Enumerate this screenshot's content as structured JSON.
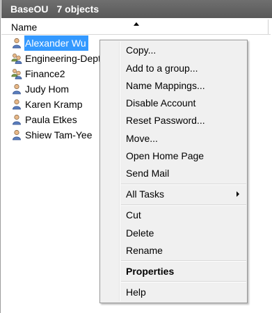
{
  "header": {
    "container_name": "BaseOU",
    "object_count": "7 objects"
  },
  "columns": {
    "name_header": "Name"
  },
  "list_items": [
    {
      "label": "Alexander Wu",
      "icon": "user-icon",
      "selected": true
    },
    {
      "label": "Engineering-Dept",
      "icon": "group-icon",
      "selected": false
    },
    {
      "label": "Finance2",
      "icon": "group-icon",
      "selected": false
    },
    {
      "label": "Judy Hom",
      "icon": "user-icon",
      "selected": false
    },
    {
      "label": "Karen Kramp",
      "icon": "user-icon",
      "selected": false
    },
    {
      "label": "Paula Etkes",
      "icon": "user-icon",
      "selected": false
    },
    {
      "label": "Shiew Tam-Yee",
      "icon": "user-icon",
      "selected": false
    }
  ],
  "context_menu": {
    "items": [
      {
        "label": "Copy..."
      },
      {
        "label": "Add to a group..."
      },
      {
        "label": "Name Mappings..."
      },
      {
        "label": "Disable Account"
      },
      {
        "label": "Reset Password..."
      },
      {
        "label": "Move..."
      },
      {
        "label": "Open Home Page"
      },
      {
        "label": "Send Mail"
      },
      {
        "label": "All Tasks",
        "submenu": true
      },
      {
        "label": "Cut"
      },
      {
        "label": "Delete"
      },
      {
        "label": "Rename"
      },
      {
        "label": "Properties",
        "bold": true
      },
      {
        "label": "Help"
      }
    ]
  },
  "colors": {
    "selection": "#3399ff",
    "titlebar": "#646464",
    "menu_background": "#f0f0f0"
  }
}
